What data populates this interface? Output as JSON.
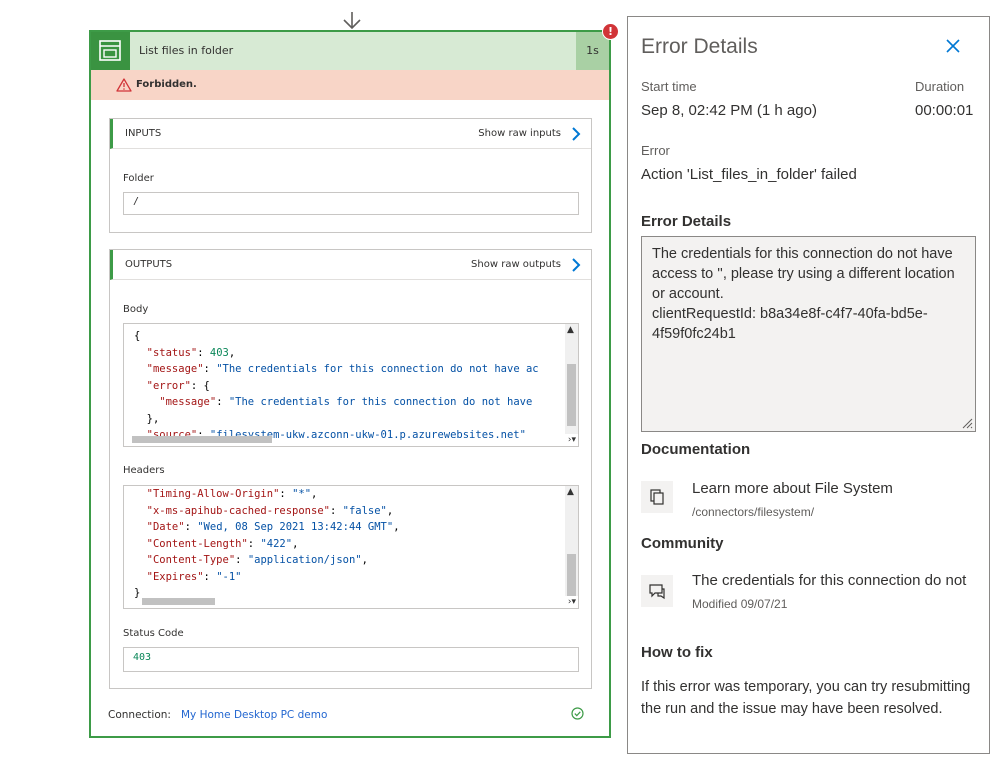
{
  "action": {
    "title": "List files in folder",
    "duration": "1s",
    "error_badge": "!",
    "status_message": "Forbidden."
  },
  "inputs": {
    "header": "INPUTS",
    "raw_link": "Show raw inputs",
    "folder_label": "Folder",
    "folder_value": "/"
  },
  "outputs": {
    "header": "OUTPUTS",
    "raw_link": "Show raw outputs",
    "body_label": "Body",
    "body_lines": [
      [
        {
          "t": "{",
          "c": "p"
        }
      ],
      [
        {
          "t": "  \"status\"",
          "c": "k"
        },
        {
          "t": ": ",
          "c": "p"
        },
        {
          "t": "403",
          "c": "n"
        },
        {
          "t": ",",
          "c": "p"
        }
      ],
      [
        {
          "t": "  \"message\"",
          "c": "k"
        },
        {
          "t": ": ",
          "c": "p"
        },
        {
          "t": "\"The credentials for this connection do not have ac",
          "c": "s"
        }
      ],
      [
        {
          "t": "  \"error\"",
          "c": "k"
        },
        {
          "t": ": {",
          "c": "p"
        }
      ],
      [
        {
          "t": "    \"message\"",
          "c": "k"
        },
        {
          "t": ": ",
          "c": "p"
        },
        {
          "t": "\"The credentials for this connection do not have",
          "c": "s"
        }
      ],
      [
        {
          "t": "  },",
          "c": "p"
        }
      ],
      [
        {
          "t": "  \"source\"",
          "c": "k"
        },
        {
          "t": ": ",
          "c": "p"
        },
        {
          "t": "\"filesystem-ukw.azconn-ukw-01.p.azurewebsites.net\"",
          "c": "s"
        }
      ]
    ],
    "headers_label": "Headers",
    "headers_lines": [
      [
        {
          "t": "  \"Timing-Allow-Origin\"",
          "c": "k"
        },
        {
          "t": ": ",
          "c": "p"
        },
        {
          "t": "\"*\"",
          "c": "s"
        },
        {
          "t": ",",
          "c": "p"
        }
      ],
      [
        {
          "t": "  \"x-ms-apihub-cached-response\"",
          "c": "k"
        },
        {
          "t": ": ",
          "c": "p"
        },
        {
          "t": "\"false\"",
          "c": "s"
        },
        {
          "t": ",",
          "c": "p"
        }
      ],
      [
        {
          "t": "  \"Date\"",
          "c": "k"
        },
        {
          "t": ": ",
          "c": "p"
        },
        {
          "t": "\"Wed, 08 Sep 2021 13:42:44 GMT\"",
          "c": "s"
        },
        {
          "t": ",",
          "c": "p"
        }
      ],
      [
        {
          "t": "  \"Content-Length\"",
          "c": "k"
        },
        {
          "t": ": ",
          "c": "p"
        },
        {
          "t": "\"422\"",
          "c": "s"
        },
        {
          "t": ",",
          "c": "p"
        }
      ],
      [
        {
          "t": "  \"Content-Type\"",
          "c": "k"
        },
        {
          "t": ": ",
          "c": "p"
        },
        {
          "t": "\"application/json\"",
          "c": "s"
        },
        {
          "t": ",",
          "c": "p"
        }
      ],
      [
        {
          "t": "  \"Expires\"",
          "c": "k"
        },
        {
          "t": ": ",
          "c": "p"
        },
        {
          "t": "\"-1\"",
          "c": "s"
        }
      ],
      [
        {
          "t": "}",
          "c": "p"
        }
      ]
    ],
    "status_code_label": "Status Code",
    "status_code_value": "403"
  },
  "connection": {
    "label": "Connection:",
    "name": "My Home Desktop PC demo"
  },
  "panel": {
    "title": "Error Details",
    "start_time_label": "Start time",
    "start_time_value": "Sep 8, 02:42 PM (1 h ago)",
    "duration_label": "Duration",
    "duration_value": "00:00:01",
    "error_label": "Error",
    "error_value": "Action 'List_files_in_folder' failed",
    "details_heading": "Error Details",
    "details_text": "The credentials for this connection do not have access to '', please try using a different location or account.\nclientRequestId: b8a34e8f-c4f7-40fa-bd5e-4f59f0fc24b1",
    "documentation_heading": "Documentation",
    "doc_title": "Learn more about File System",
    "doc_path": "/connectors/filesystem/",
    "community_heading": "Community",
    "community_title": "The credentials for this connection do not",
    "community_sub": "Modified 09/07/21",
    "howtofix_heading": "How to fix",
    "howtofix_text": "If this error was temporary, you can try resubmitting the run and the issue may have been resolved."
  },
  "colors": {
    "success_green": "#3d9b47",
    "error_red": "#d13438",
    "link_blue": "#2266d0",
    "forbidden_bg": "#f8d5c7"
  },
  "icons": {
    "card": "folder-list-icon",
    "warning": "warning-triangle-icon",
    "close": "close-icon",
    "doc": "document-icon",
    "community": "chat-icon",
    "connection_status": "check-circle-icon"
  }
}
